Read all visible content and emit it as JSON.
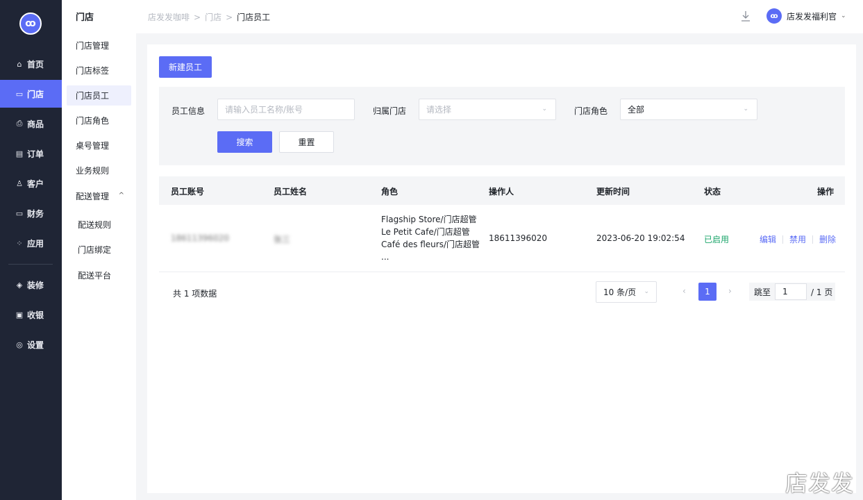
{
  "rail": {
    "logo": "ꝏ",
    "items": [
      {
        "icon": "⌂",
        "label": "首页"
      },
      {
        "icon": "▭",
        "label": "门店"
      },
      {
        "icon": "⎙",
        "label": "商品"
      },
      {
        "icon": "▤",
        "label": "订单"
      },
      {
        "icon": "♙",
        "label": "客户"
      },
      {
        "icon": "▭",
        "label": "财务"
      },
      {
        "icon": "⁘",
        "label": "应用"
      },
      {
        "icon": "◈",
        "label": "装修"
      },
      {
        "icon": "▣",
        "label": "收银"
      },
      {
        "icon": "◎",
        "label": "设置"
      }
    ]
  },
  "subnav": {
    "title": "门店",
    "items": [
      "门店管理",
      "门店标签",
      "门店员工",
      "门店角色",
      "桌号管理",
      "业务规则",
      "配送管理"
    ],
    "delivery_chevron": "^",
    "children": [
      "配送规则",
      "门店绑定",
      "配送平台"
    ]
  },
  "header": {
    "breadcrumb": [
      "店发发咖啡",
      "门店",
      "门店员工"
    ],
    "separator": ">",
    "user_avatar": "ꝏ",
    "user_name": "店发发福利官",
    "user_chevron": "⌄"
  },
  "toolbar": {
    "new_label": "新建员工"
  },
  "filter": {
    "employee_label": "员工信息",
    "employee_placeholder": "请输入员工名称/账号",
    "store_label": "归属门店",
    "store_placeholder": "请选择",
    "role_label": "门店角色",
    "role_value": "全部",
    "search_label": "搜索",
    "reset_label": "重置",
    "chevron": "⌄"
  },
  "table": {
    "columns": [
      "员工账号",
      "员工姓名",
      "角色",
      "操作人",
      "更新时间",
      "状态",
      "操作"
    ],
    "rows": [
      {
        "account": "18611396020",
        "name": "张三",
        "roles": [
          "Flagship Store/门店超管",
          "Le Petit Cafe/门店超管",
          "Café des fleurs/门店超管",
          "..."
        ],
        "operator": "18611396020",
        "updated": "2023-06-20 19:02:54",
        "status": "已启用",
        "actions": [
          "编辑",
          "禁用",
          "删除"
        ]
      }
    ]
  },
  "pagination": {
    "total": "共 1 项数据",
    "page_size": "10 条/页",
    "prev": "‹",
    "current": "1",
    "next": "›",
    "jump_label": "跳至",
    "jump_value": "1",
    "pages_suffix": "/ 1 页"
  },
  "watermark": "店发发",
  "colors": {
    "accent": "#5b6cf5",
    "rail_bg": "#1f2535",
    "status_enabled": "#1aa56a"
  }
}
